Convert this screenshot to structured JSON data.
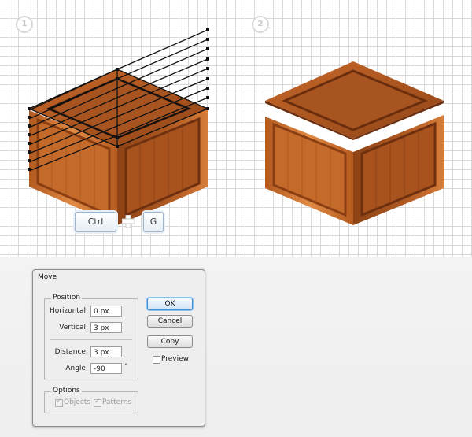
{
  "steps": [
    {
      "number": "1"
    },
    {
      "number": "2"
    }
  ],
  "shortcut": {
    "key1": "Ctrl",
    "key2": "G",
    "plus_icon": "plus-icon"
  },
  "dialog": {
    "title": "Move",
    "position": {
      "legend": "Position",
      "horizontal_label": "Horizontal:",
      "horizontal_value": "0 px",
      "vertical_label": "Vertical:",
      "vertical_value": "3 px",
      "distance_label": "Distance:",
      "distance_value": "3 px",
      "angle_label": "Angle:",
      "angle_value": "-90",
      "angle_unit": "°"
    },
    "options": {
      "legend": "Options",
      "objects_label": "Objects",
      "objects_checked": true,
      "patterns_label": "Patterns",
      "patterns_checked": true
    },
    "buttons": {
      "ok": "OK",
      "cancel": "Cancel",
      "copy": "Copy"
    },
    "preview": {
      "label": "Preview",
      "checked": false
    }
  },
  "colors": {
    "grid_line": "#d9d9d9",
    "wood_light": "#d9772e",
    "wood_mid": "#b85a1f",
    "wood_dark": "#7e3a12",
    "selection": "#111111",
    "accent_blue": "#3f8fd8"
  }
}
